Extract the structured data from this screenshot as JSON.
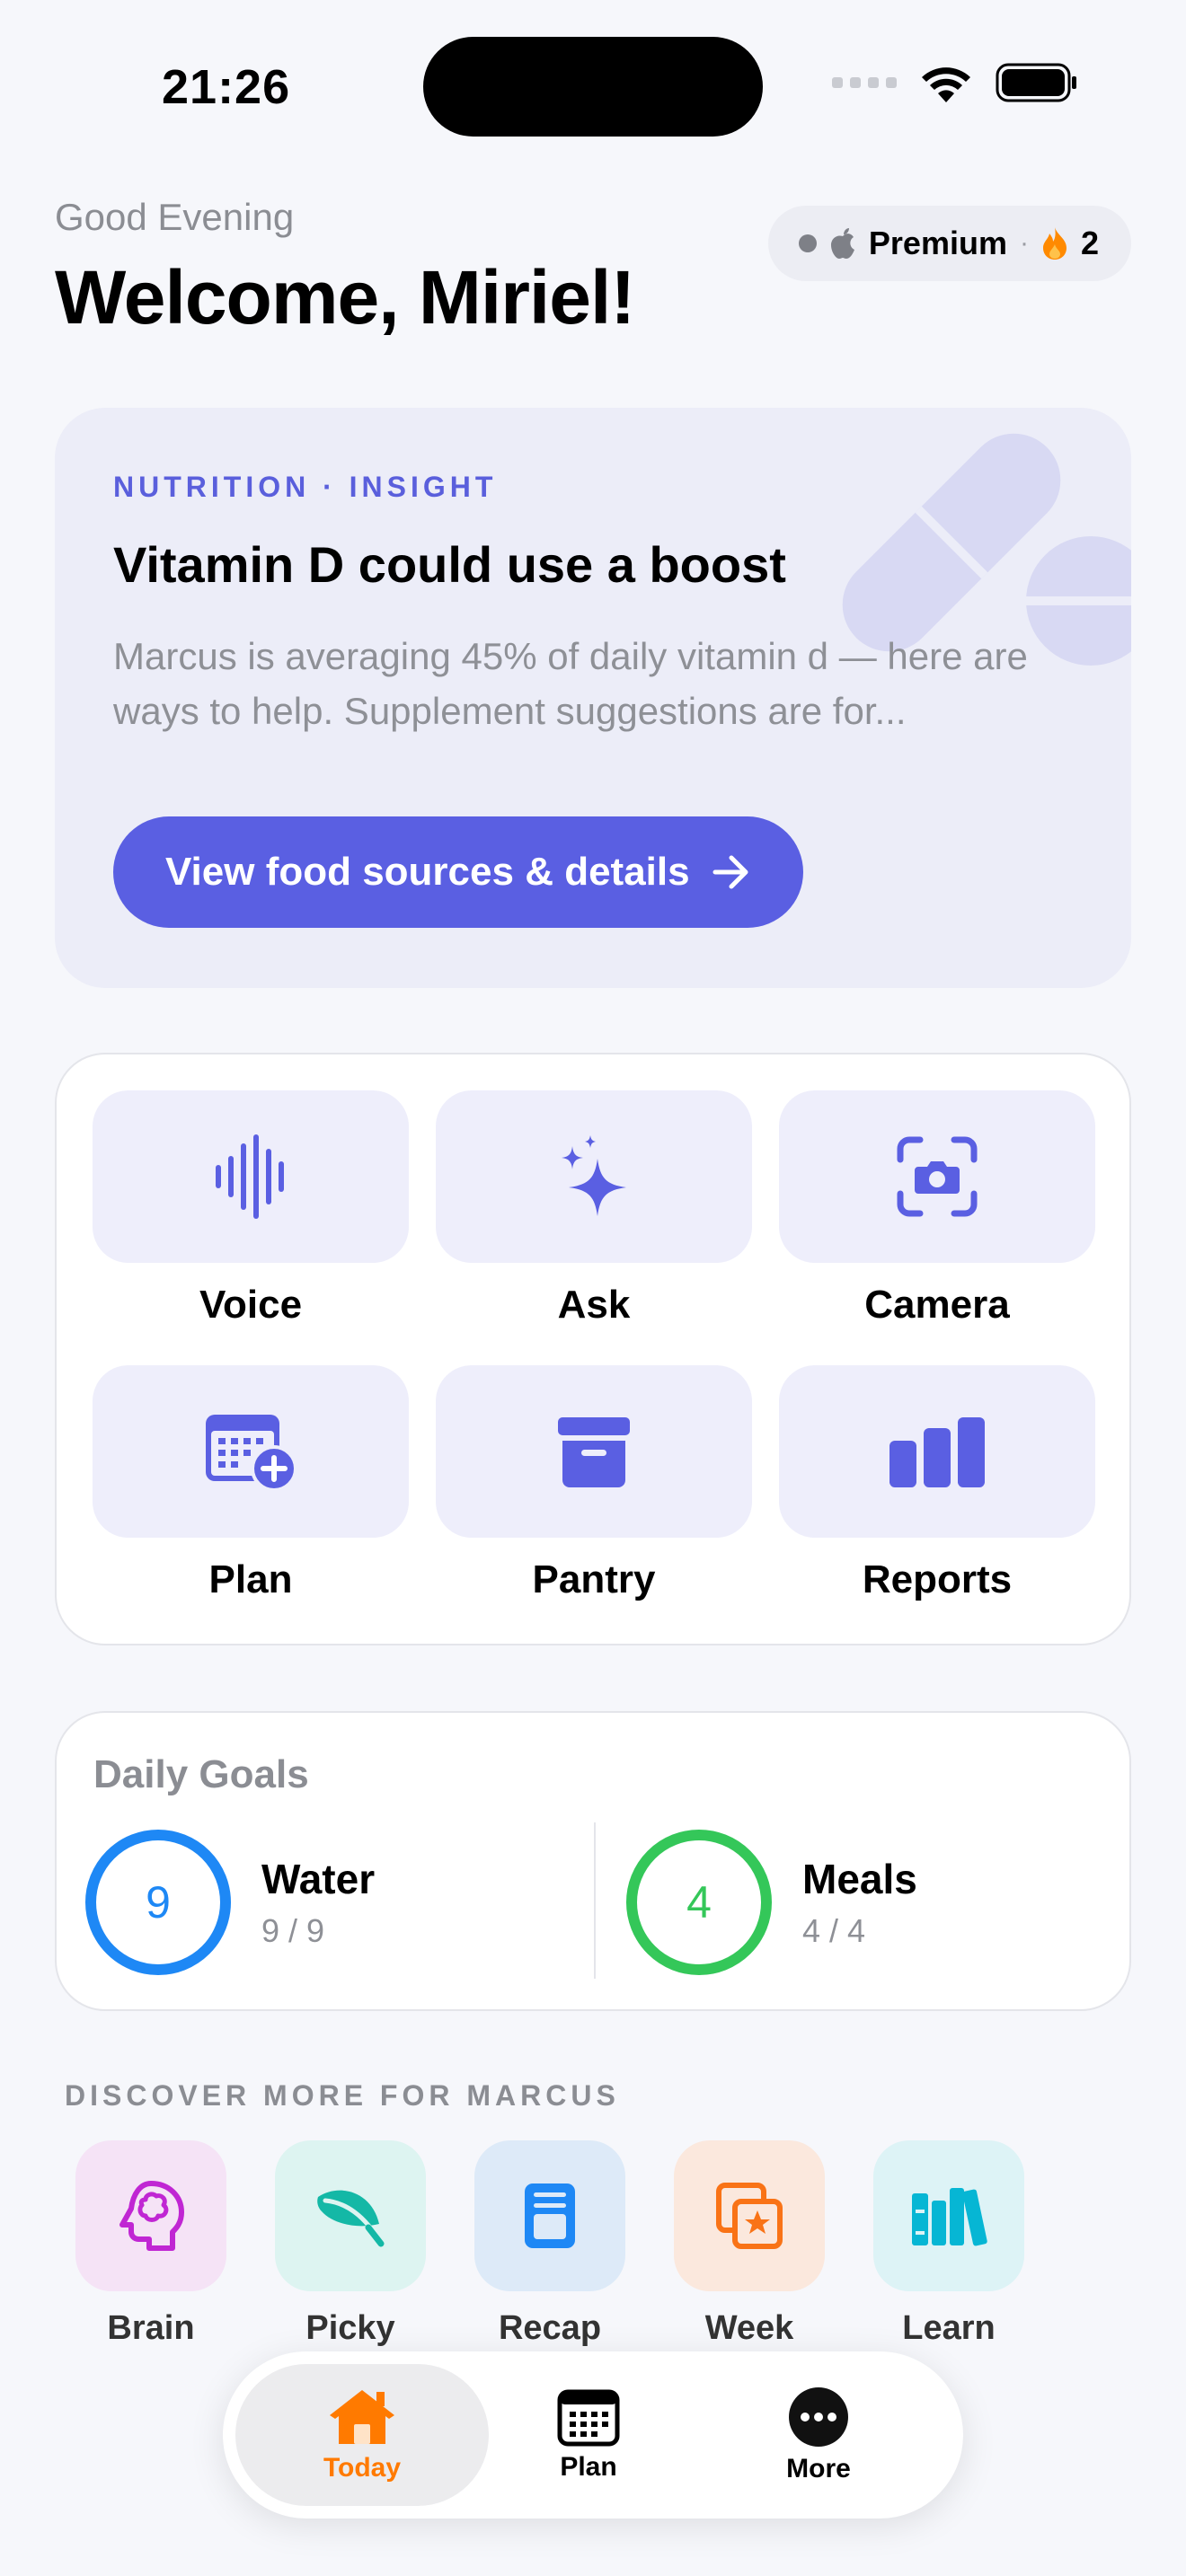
{
  "status_bar": {
    "time": "21:26"
  },
  "header": {
    "greeting": "Good Evening",
    "welcome": "Welcome, Miriel!",
    "premium_label": "Premium",
    "streak_count": "2"
  },
  "insight": {
    "eyebrow": "NUTRITION · INSIGHT",
    "title": "Vitamin D could use a boost",
    "body": "Marcus is averaging 45% of daily vitamin d — here are ways to help. Supplement suggestions are for...",
    "cta_label": "View food sources & details"
  },
  "quick_actions": [
    {
      "label": "Voice",
      "icon": "waveform-icon"
    },
    {
      "label": "Ask",
      "icon": "sparkles-icon"
    },
    {
      "label": "Camera",
      "icon": "camera-scan-icon"
    },
    {
      "label": "Plan",
      "icon": "calendar-add-icon"
    },
    {
      "label": "Pantry",
      "icon": "archive-box-icon"
    },
    {
      "label": "Reports",
      "icon": "bar-chart-icon"
    }
  ],
  "daily_goals": {
    "title": "Daily Goals",
    "items": [
      {
        "name": "Water",
        "value": "9",
        "progress": "9 / 9",
        "color": "#1E88F5"
      },
      {
        "name": "Meals",
        "value": "4",
        "progress": "4 / 4",
        "color": "#34C759"
      }
    ]
  },
  "discover": {
    "title": "DISCOVER MORE FOR MARCUS",
    "items": [
      {
        "label": "Brain",
        "icon": "brain-icon",
        "color": "#C026D3"
      },
      {
        "label": "Picky",
        "icon": "leaf-icon",
        "color": "#14B8A6"
      },
      {
        "label": "Recap",
        "icon": "document-icon",
        "color": "#1E88F5"
      },
      {
        "label": "Week",
        "icon": "star-photo-icon",
        "color": "#F97316"
      },
      {
        "label": "Learn",
        "icon": "books-icon",
        "color": "#06B6D4"
      }
    ]
  },
  "tab_bar": {
    "tabs": [
      {
        "label": "Today",
        "icon": "house-icon",
        "active": true
      },
      {
        "label": "Plan",
        "icon": "calendar-icon",
        "active": false
      },
      {
        "label": "More",
        "icon": "ellipsis-circle-icon",
        "active": false
      }
    ]
  },
  "colors": {
    "accent": "#5A5FE2",
    "background": "#F6F7FB",
    "active_tab": "#FF7A00"
  }
}
